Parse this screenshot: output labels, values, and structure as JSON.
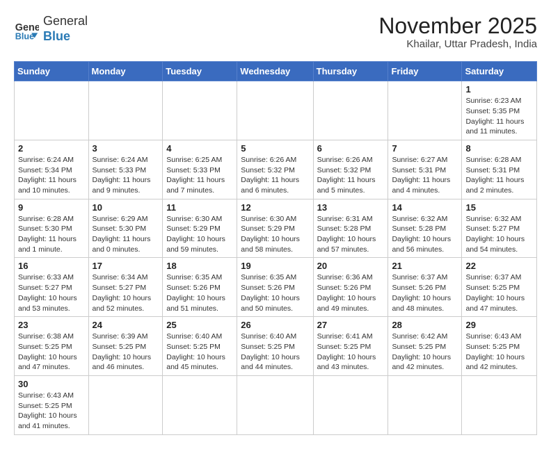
{
  "logo": {
    "text_normal": "General",
    "text_bold": "Blue"
  },
  "title": "November 2025",
  "subtitle": "Khailar, Uttar Pradesh, India",
  "weekdays": [
    "Sunday",
    "Monday",
    "Tuesday",
    "Wednesday",
    "Thursday",
    "Friday",
    "Saturday"
  ],
  "weeks": [
    [
      {
        "day": "",
        "info": ""
      },
      {
        "day": "",
        "info": ""
      },
      {
        "day": "",
        "info": ""
      },
      {
        "day": "",
        "info": ""
      },
      {
        "day": "",
        "info": ""
      },
      {
        "day": "",
        "info": ""
      },
      {
        "day": "1",
        "info": "Sunrise: 6:23 AM\nSunset: 5:35 PM\nDaylight: 11 hours and 11 minutes."
      }
    ],
    [
      {
        "day": "2",
        "info": "Sunrise: 6:24 AM\nSunset: 5:34 PM\nDaylight: 11 hours and 10 minutes."
      },
      {
        "day": "3",
        "info": "Sunrise: 6:24 AM\nSunset: 5:33 PM\nDaylight: 11 hours and 9 minutes."
      },
      {
        "day": "4",
        "info": "Sunrise: 6:25 AM\nSunset: 5:33 PM\nDaylight: 11 hours and 7 minutes."
      },
      {
        "day": "5",
        "info": "Sunrise: 6:26 AM\nSunset: 5:32 PM\nDaylight: 11 hours and 6 minutes."
      },
      {
        "day": "6",
        "info": "Sunrise: 6:26 AM\nSunset: 5:32 PM\nDaylight: 11 hours and 5 minutes."
      },
      {
        "day": "7",
        "info": "Sunrise: 6:27 AM\nSunset: 5:31 PM\nDaylight: 11 hours and 4 minutes."
      },
      {
        "day": "8",
        "info": "Sunrise: 6:28 AM\nSunset: 5:31 PM\nDaylight: 11 hours and 2 minutes."
      }
    ],
    [
      {
        "day": "9",
        "info": "Sunrise: 6:28 AM\nSunset: 5:30 PM\nDaylight: 11 hours and 1 minute."
      },
      {
        "day": "10",
        "info": "Sunrise: 6:29 AM\nSunset: 5:30 PM\nDaylight: 11 hours and 0 minutes."
      },
      {
        "day": "11",
        "info": "Sunrise: 6:30 AM\nSunset: 5:29 PM\nDaylight: 10 hours and 59 minutes."
      },
      {
        "day": "12",
        "info": "Sunrise: 6:30 AM\nSunset: 5:29 PM\nDaylight: 10 hours and 58 minutes."
      },
      {
        "day": "13",
        "info": "Sunrise: 6:31 AM\nSunset: 5:28 PM\nDaylight: 10 hours and 57 minutes."
      },
      {
        "day": "14",
        "info": "Sunrise: 6:32 AM\nSunset: 5:28 PM\nDaylight: 10 hours and 56 minutes."
      },
      {
        "day": "15",
        "info": "Sunrise: 6:32 AM\nSunset: 5:27 PM\nDaylight: 10 hours and 54 minutes."
      }
    ],
    [
      {
        "day": "16",
        "info": "Sunrise: 6:33 AM\nSunset: 5:27 PM\nDaylight: 10 hours and 53 minutes."
      },
      {
        "day": "17",
        "info": "Sunrise: 6:34 AM\nSunset: 5:27 PM\nDaylight: 10 hours and 52 minutes."
      },
      {
        "day": "18",
        "info": "Sunrise: 6:35 AM\nSunset: 5:26 PM\nDaylight: 10 hours and 51 minutes."
      },
      {
        "day": "19",
        "info": "Sunrise: 6:35 AM\nSunset: 5:26 PM\nDaylight: 10 hours and 50 minutes."
      },
      {
        "day": "20",
        "info": "Sunrise: 6:36 AM\nSunset: 5:26 PM\nDaylight: 10 hours and 49 minutes."
      },
      {
        "day": "21",
        "info": "Sunrise: 6:37 AM\nSunset: 5:26 PM\nDaylight: 10 hours and 48 minutes."
      },
      {
        "day": "22",
        "info": "Sunrise: 6:37 AM\nSunset: 5:25 PM\nDaylight: 10 hours and 47 minutes."
      }
    ],
    [
      {
        "day": "23",
        "info": "Sunrise: 6:38 AM\nSunset: 5:25 PM\nDaylight: 10 hours and 47 minutes."
      },
      {
        "day": "24",
        "info": "Sunrise: 6:39 AM\nSunset: 5:25 PM\nDaylight: 10 hours and 46 minutes."
      },
      {
        "day": "25",
        "info": "Sunrise: 6:40 AM\nSunset: 5:25 PM\nDaylight: 10 hours and 45 minutes."
      },
      {
        "day": "26",
        "info": "Sunrise: 6:40 AM\nSunset: 5:25 PM\nDaylight: 10 hours and 44 minutes."
      },
      {
        "day": "27",
        "info": "Sunrise: 6:41 AM\nSunset: 5:25 PM\nDaylight: 10 hours and 43 minutes."
      },
      {
        "day": "28",
        "info": "Sunrise: 6:42 AM\nSunset: 5:25 PM\nDaylight: 10 hours and 42 minutes."
      },
      {
        "day": "29",
        "info": "Sunrise: 6:43 AM\nSunset: 5:25 PM\nDaylight: 10 hours and 42 minutes."
      }
    ],
    [
      {
        "day": "30",
        "info": "Sunrise: 6:43 AM\nSunset: 5:25 PM\nDaylight: 10 hours and 41 minutes."
      },
      {
        "day": "",
        "info": ""
      },
      {
        "day": "",
        "info": ""
      },
      {
        "day": "",
        "info": ""
      },
      {
        "day": "",
        "info": ""
      },
      {
        "day": "",
        "info": ""
      },
      {
        "day": "",
        "info": ""
      }
    ]
  ]
}
